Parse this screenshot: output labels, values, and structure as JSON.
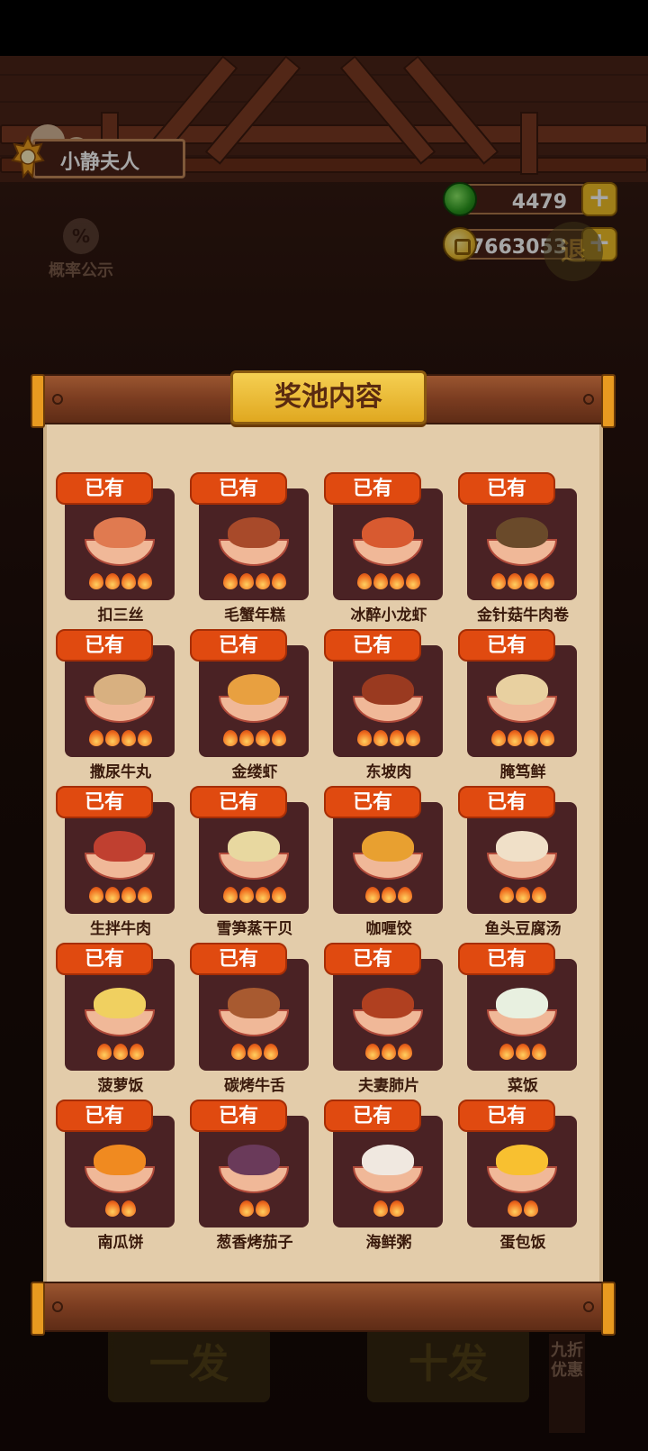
{
  "player": {
    "name": "小静夫人"
  },
  "currency": {
    "jade": {
      "icon": "jade-icon",
      "value": "4479"
    },
    "coin": {
      "icon": "coin-icon",
      "value": "7663053"
    },
    "plus_label": "+"
  },
  "probability_button": {
    "icon": "percent-gear-icon",
    "label": "概率公示",
    "glyph": "%"
  },
  "exit_button": {
    "label": "退"
  },
  "draw_buttons": {
    "single": "一发",
    "ten": "十发"
  },
  "discount_label": "九折优惠",
  "panel": {
    "title": "奖池内容"
  },
  "owned_label": "已有",
  "items": [
    {
      "name": "扣三丝",
      "flames": 4,
      "color": "#e07a50"
    },
    {
      "name": "毛蟹年糕",
      "flames": 4,
      "color": "#a84a2a"
    },
    {
      "name": "冰醉小龙虾",
      "flames": 4,
      "color": "#d85a30"
    },
    {
      "name": "金针菇牛肉卷",
      "flames": 4,
      "color": "#6a4a2a"
    },
    {
      "name": "撒尿牛丸",
      "flames": 4,
      "color": "#d8b080"
    },
    {
      "name": "金缕虾",
      "flames": 4,
      "color": "#e8a040"
    },
    {
      "name": "东坡肉",
      "flames": 4,
      "color": "#9a3a20"
    },
    {
      "name": "腌笃鲜",
      "flames": 4,
      "color": "#e8d0a0"
    },
    {
      "name": "生拌牛肉",
      "flames": 4,
      "color": "#c04030"
    },
    {
      "name": "雪笋蒸干贝",
      "flames": 4,
      "color": "#e8d8a0"
    },
    {
      "name": "咖喱饺",
      "flames": 3,
      "color": "#e8a030"
    },
    {
      "name": "鱼头豆腐汤",
      "flames": 3,
      "color": "#f0e0c8"
    },
    {
      "name": "菠萝饭",
      "flames": 3,
      "color": "#f0d060"
    },
    {
      "name": "碳烤牛舌",
      "flames": 3,
      "color": "#a85a30"
    },
    {
      "name": "夫妻肺片",
      "flames": 3,
      "color": "#b04020"
    },
    {
      "name": "菜饭",
      "flames": 3,
      "color": "#e8f0e0"
    },
    {
      "name": "南瓜饼",
      "flames": 2,
      "color": "#f08a20"
    },
    {
      "name": "葱香烤茄子",
      "flames": 2,
      "color": "#6a3a5a"
    },
    {
      "name": "海鲜粥",
      "flames": 2,
      "color": "#f0e8e0"
    },
    {
      "name": "蛋包饭",
      "flames": 2,
      "color": "#f8c030"
    }
  ]
}
